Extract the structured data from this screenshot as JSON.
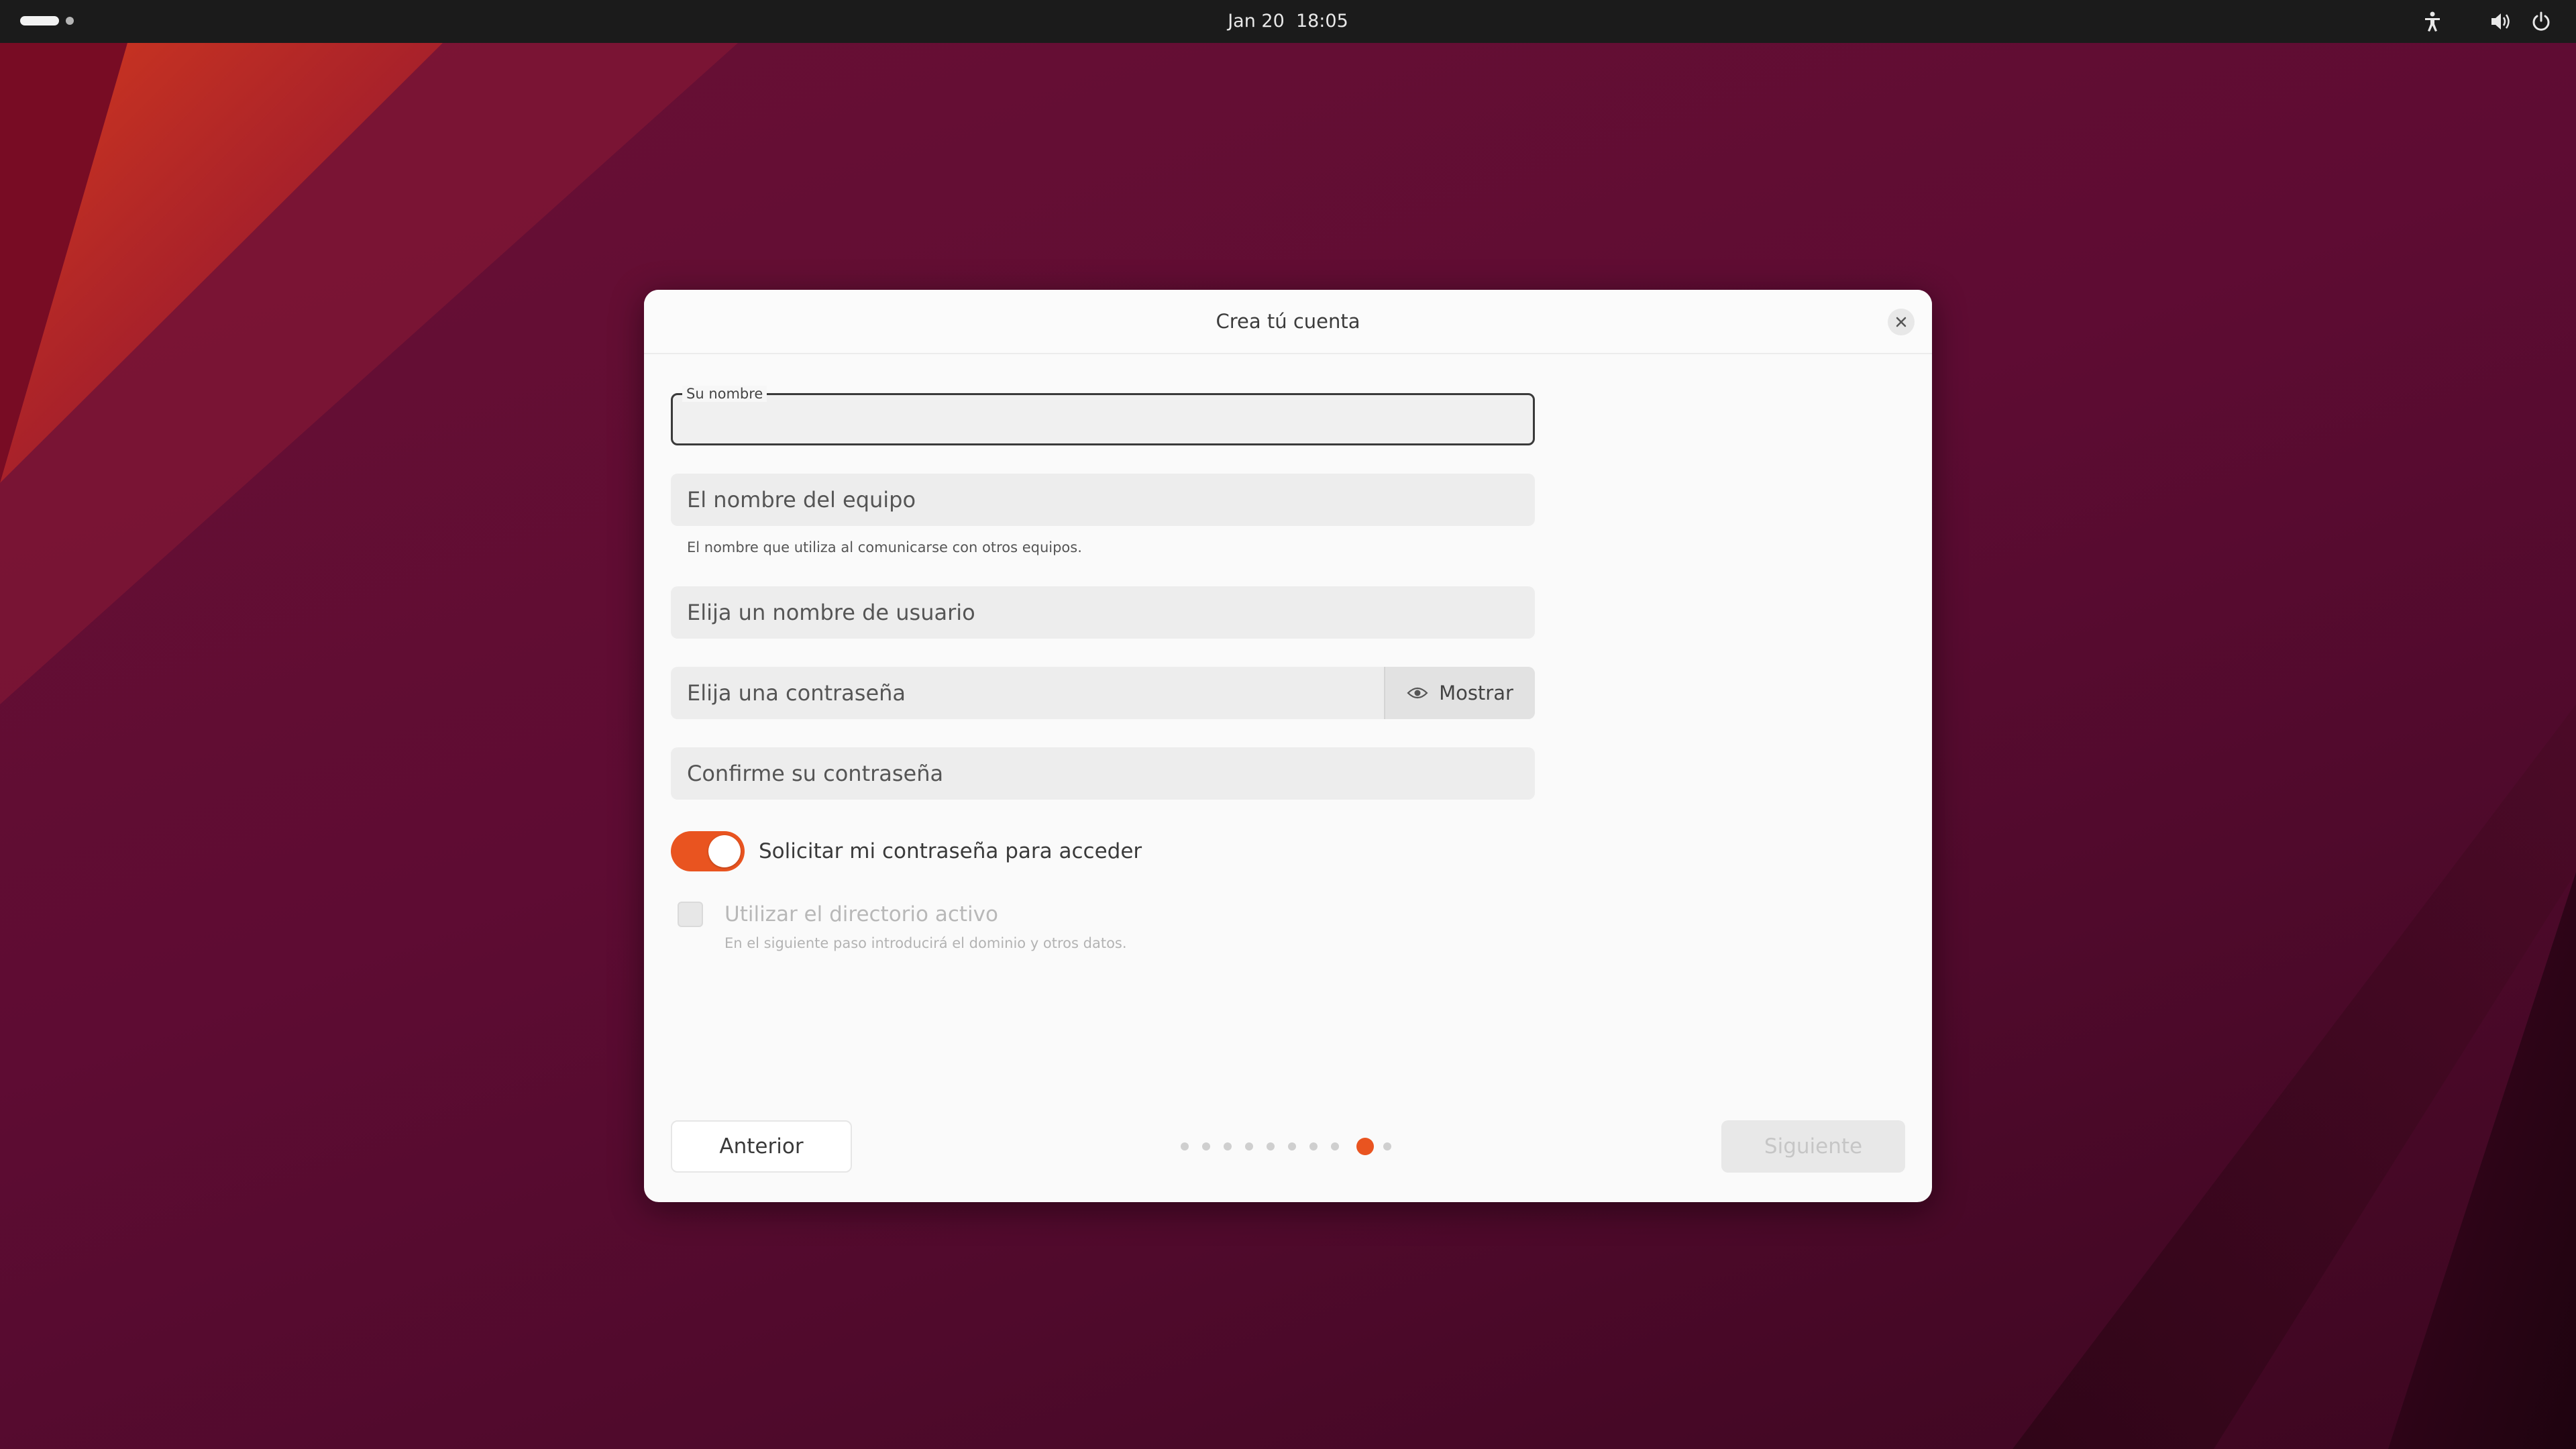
{
  "topbar": {
    "date": "Jan 20",
    "time": "18:05",
    "icons": [
      "activities-indicator",
      "accessibility-icon",
      "volume-icon",
      "power-icon"
    ]
  },
  "dialog": {
    "title": "Crea tú cuenta",
    "fields": {
      "name": {
        "label": "Su nombre",
        "value": ""
      },
      "computer": {
        "placeholder": "El nombre del equipo",
        "hint": "El nombre que utiliza al comunicarse con otros equipos."
      },
      "username": {
        "placeholder": "Elija un nombre de usuario"
      },
      "password": {
        "placeholder": "Elija una contraseña",
        "show_label": "Mostrar"
      },
      "confirm": {
        "placeholder": "Confirme su contraseña"
      }
    },
    "require_password": {
      "label": "Solicitar mi contraseña para acceder",
      "checked": true
    },
    "active_directory": {
      "label": "Utilizar el directorio activo",
      "hint": "En el siguiente paso introducirá el dominio y otros datos.",
      "checked": false,
      "enabled": false
    },
    "buttons": {
      "previous": "Anterior",
      "next": "Siguiente"
    },
    "pager": {
      "total": 10,
      "current": 9
    }
  },
  "colors": {
    "accent": "#e95420",
    "topbar": "#1b1b1b",
    "wallpaper_primary": "#5e0c33",
    "wallpaper_highlight": "#c8321c"
  }
}
